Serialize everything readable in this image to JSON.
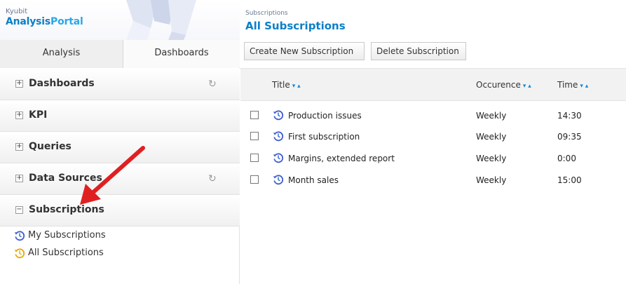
{
  "brand": {
    "small": "Kyubit",
    "big_part1": "Analysis",
    "big_part2": "Portal"
  },
  "tabs": [
    {
      "label": "Analysis"
    },
    {
      "label": "Dashboards"
    }
  ],
  "sections": [
    {
      "label": "Dashboards",
      "box": "+",
      "refresh": "↻"
    },
    {
      "label": "KPI",
      "box": "+"
    },
    {
      "label": "Queries",
      "box": "+"
    },
    {
      "label": "Data Sources",
      "box": "+",
      "refresh": "↻"
    },
    {
      "label": "Subscriptions",
      "box": "−"
    }
  ],
  "sub_items": [
    {
      "label": "My Subscriptions",
      "icon_color": "#3b5fd0"
    },
    {
      "label": "All Subscriptions",
      "icon_color": "#e8a800"
    }
  ],
  "main": {
    "breadcrumb": "Subscriptions",
    "title": "All Subscriptions",
    "buttons": {
      "create": "Create New Subscription",
      "delete": "Delete Subscription"
    },
    "columns": {
      "title": "Title",
      "occurence": "Occurence",
      "time": "Time",
      "sort_glyph": "▾ ▴"
    },
    "rows": [
      {
        "title": "Production issues",
        "occurence": "Weekly",
        "time": "14:30"
      },
      {
        "title": "First subscription",
        "occurence": "Weekly",
        "time": "09:35"
      },
      {
        "title": "Margins, extended report",
        "occurence": "Weekly",
        "time": "0:00"
      },
      {
        "title": "Month sales",
        "occurence": "Weekly",
        "time": "15:00"
      }
    ]
  },
  "colors": {
    "accent": "#0b7fc7",
    "arrow": "#e02020",
    "clock_blue": "#3b5fd0",
    "clock_yellow": "#e8a800"
  }
}
